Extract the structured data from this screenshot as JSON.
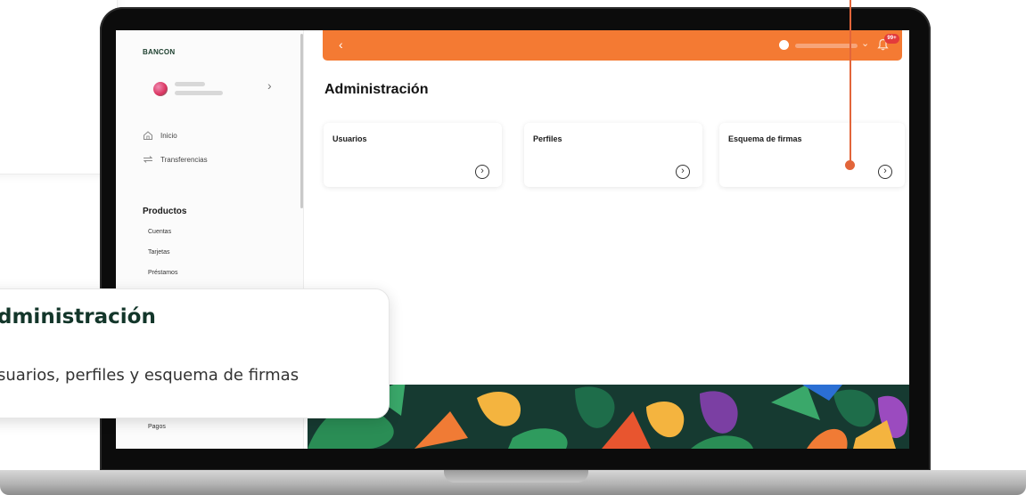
{
  "brand": {
    "logo": "BANCON",
    "accent": "#f47a33",
    "pointer_color": "#e2653a"
  },
  "sidebar": {
    "user_chevron": "›",
    "nav": [
      {
        "label": "Inicio",
        "icon": "home-icon"
      },
      {
        "label": "Transferencias",
        "icon": "transfer-icon"
      }
    ],
    "sections": [
      {
        "title": "Productos",
        "items": [
          "Cuentas",
          "Tarjetas",
          "Préstamos"
        ]
      }
    ],
    "bottom_item": "Pagos"
  },
  "header": {
    "back": "‹",
    "chevron": "⌄",
    "bell": "🔔",
    "notifications": "99+"
  },
  "main": {
    "title": "Administración",
    "cards": [
      {
        "title": "Usuarios",
        "icon": "chevron-right-circle-icon"
      },
      {
        "title": "Perfiles",
        "icon": "chevron-right-circle-icon"
      },
      {
        "title": "Esquema de firmas",
        "icon": "chevron-right-circle-icon"
      }
    ]
  },
  "callout": {
    "title": "dministración",
    "text": "suarios, perfiles y esquema de firmas"
  }
}
